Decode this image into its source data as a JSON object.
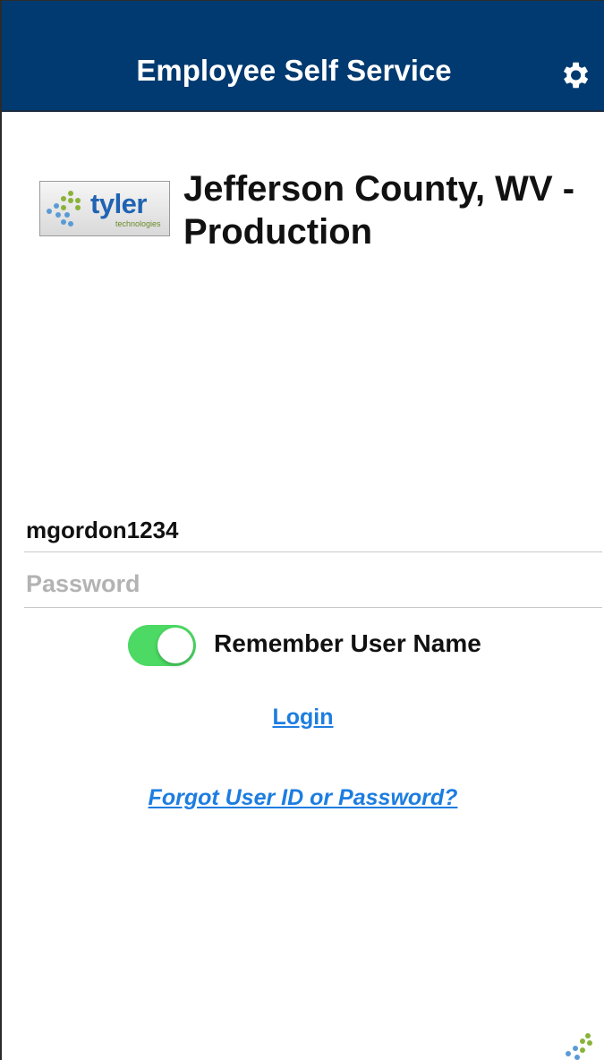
{
  "app": {
    "title": "Employee Self Service",
    "settings_icon": "gear-icon"
  },
  "branding": {
    "logo_text": "tyler",
    "logo_subtext": "technologies",
    "org_name": "Jefferson County, WV - Production"
  },
  "form": {
    "username_value": "mgordon1234",
    "password_placeholder": "Password",
    "remember_label": "Remember User Name",
    "remember_on": true
  },
  "links": {
    "login": "Login",
    "forgot": "Forgot User ID or Password?"
  },
  "colors": {
    "header_bg": "#003a70",
    "toggle_on": "#4cd964",
    "link": "#1d7de0"
  }
}
